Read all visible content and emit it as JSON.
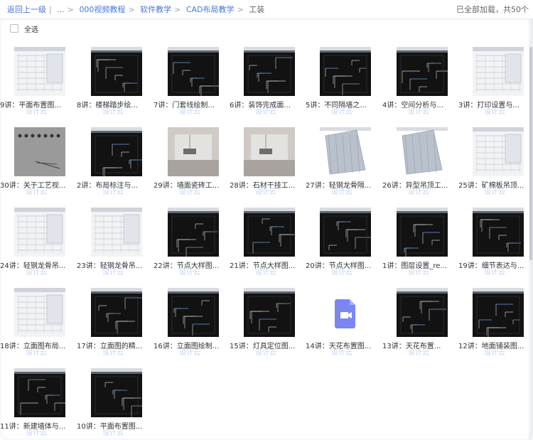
{
  "breadcrumb": [
    {
      "label": "返回上一级"
    },
    {
      "label": "..."
    },
    {
      "label": "000视频教程"
    },
    {
      "label": "软件教学"
    },
    {
      "label": "CAD布局教学"
    },
    {
      "label": "工装"
    }
  ],
  "top_right_text": "已全部加载，共50个",
  "select_all_label": "全选",
  "watermark_text": "设计云",
  "colors": {
    "link": "#4a76d8",
    "video_icon": "#7b86f3",
    "dark_thumb": "#111111"
  },
  "files": [
    {
      "label": "9讲：平面布置图...",
      "thumb": "light"
    },
    {
      "label": "8讲：楼梯踏步绘...",
      "thumb": "dark"
    },
    {
      "label": "7讲：门套线绘制...",
      "thumb": "dark"
    },
    {
      "label": "6讲：装饰完成面...",
      "thumb": "dark"
    },
    {
      "label": "5讲：不同隔墙之...",
      "thumb": "dark"
    },
    {
      "label": "4讲：空间分析与...",
      "thumb": "dark"
    },
    {
      "label": "3讲：打印设置与...",
      "thumb": "light"
    },
    {
      "label": "30讲：关于工艺视...",
      "thumb": "gray"
    },
    {
      "label": "2讲：布局标注与...",
      "thumb": "dark"
    },
    {
      "label": "29讲：墙面瓷砖工...",
      "thumb": "photo"
    },
    {
      "label": "28讲：石材干挂工...",
      "thumb": "photo"
    },
    {
      "label": "27讲：轻钢龙骨隔...",
      "thumb": "render"
    },
    {
      "label": "26讲：异型吊顶工...",
      "thumb": "render"
    },
    {
      "label": "25讲：矿棉板吊顶...",
      "thumb": "light"
    },
    {
      "label": "24讲：轻钢龙骨吊...",
      "thumb": "light"
    },
    {
      "label": "23讲：轻钢龙骨吊...",
      "thumb": "light"
    },
    {
      "label": "22讲：节点大样图...",
      "thumb": "dark"
    },
    {
      "label": "21讲：节点大样图...",
      "thumb": "dark"
    },
    {
      "label": "20讲：节点大样图...",
      "thumb": "dark"
    },
    {
      "label": "1讲：图层设置_re...",
      "thumb": "dark"
    },
    {
      "label": "19讲：细节表达与...",
      "thumb": "dark"
    },
    {
      "label": "18讲：立面图布局...",
      "thumb": "light"
    },
    {
      "label": "17讲：立面图的精...",
      "thumb": "dark"
    },
    {
      "label": "16讲：立面图绘制...",
      "thumb": "dark"
    },
    {
      "label": "15讲：灯具定位图...",
      "thumb": "dark"
    },
    {
      "label": "14讲：天花布置图...",
      "thumb": "video-icon"
    },
    {
      "label": "13讲：天花布置...",
      "thumb": "dark"
    },
    {
      "label": "12讲：地面铺装图...",
      "thumb": "dark"
    },
    {
      "label": "11讲：新建墙体与...",
      "thumb": "dark"
    },
    {
      "label": "10讲：平面布置图...",
      "thumb": "dark"
    }
  ]
}
